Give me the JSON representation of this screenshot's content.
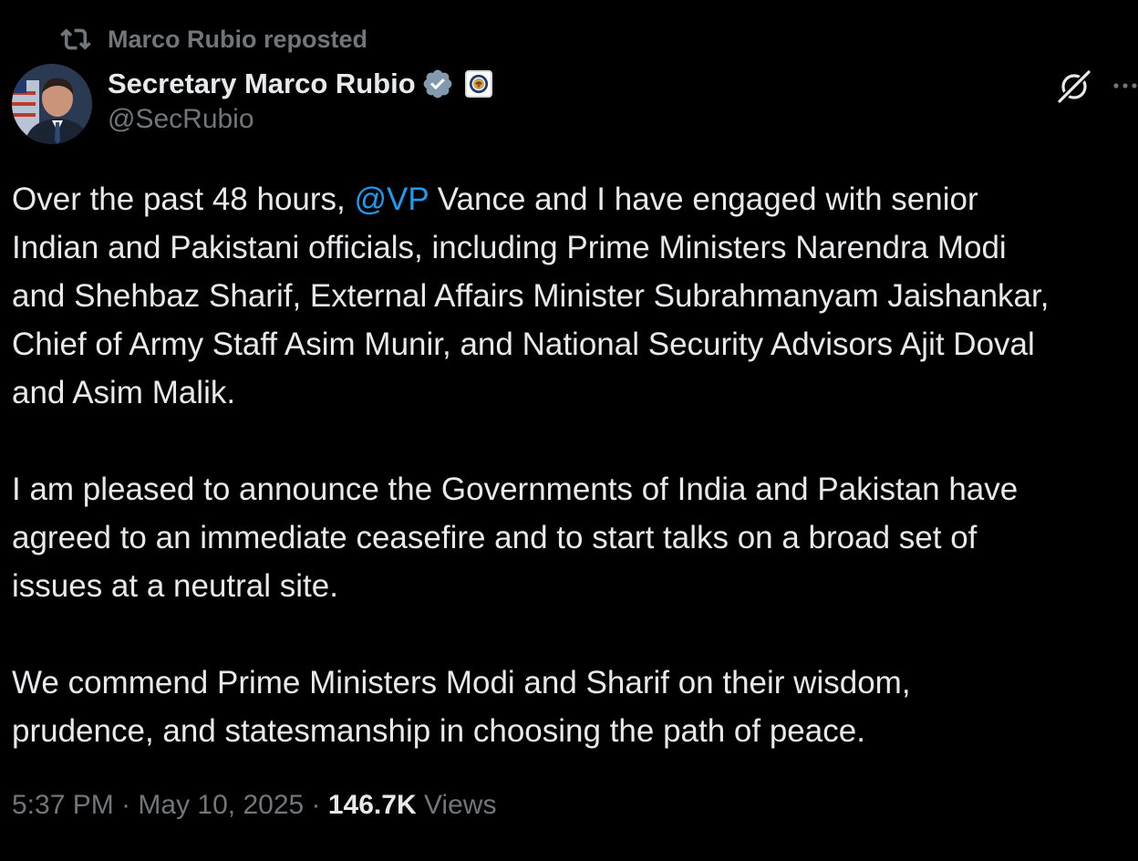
{
  "repost": {
    "label": "Marco Rubio reposted",
    "icon": "repost-icon"
  },
  "author": {
    "display_name": "Secretary Marco Rubio",
    "handle": "@SecRubio",
    "verified_badge_color": "#829aab",
    "avatar_icon": "avatar-photo",
    "affiliate_icon": "state-department-seal-icon"
  },
  "actions": {
    "grok_icon": "grok-icon",
    "more_icon": "more-icon"
  },
  "tweet": {
    "line1_pre": "Over the past 48 hours, ",
    "mention": "@VP",
    "line1_post": " Vance and I have engaged with senior",
    "line2": "Indian and Pakistani officials, including Prime Ministers Narendra Modi",
    "line3": "and Shehbaz Sharif, External Affairs Minister Subrahmanyam Jaishankar,",
    "line4": "Chief of Army Staff Asim Munir, and National Security Advisors Ajit Doval",
    "line5": "and Asim Malik.",
    "para2_line1": "I am pleased to announce the Governments of India and Pakistan have",
    "para2_line2": "agreed to an immediate ceasefire and to start talks on a broad set of",
    "para2_line3": "issues at a neutral site.",
    "para3_line1": "We commend Prime Ministers Modi and Sharif on their wisdom,",
    "para3_line2": "prudence, and statesmanship in choosing the path of peace."
  },
  "meta": {
    "time": "5:37 PM",
    "separator": " · ",
    "date": "May 10, 2025",
    "views_count": "146.7K",
    "views_label": "Views"
  },
  "colors": {
    "background": "#000000",
    "text": "#e7e9ea",
    "secondary": "#71767b",
    "link": "#1d9bf0"
  }
}
